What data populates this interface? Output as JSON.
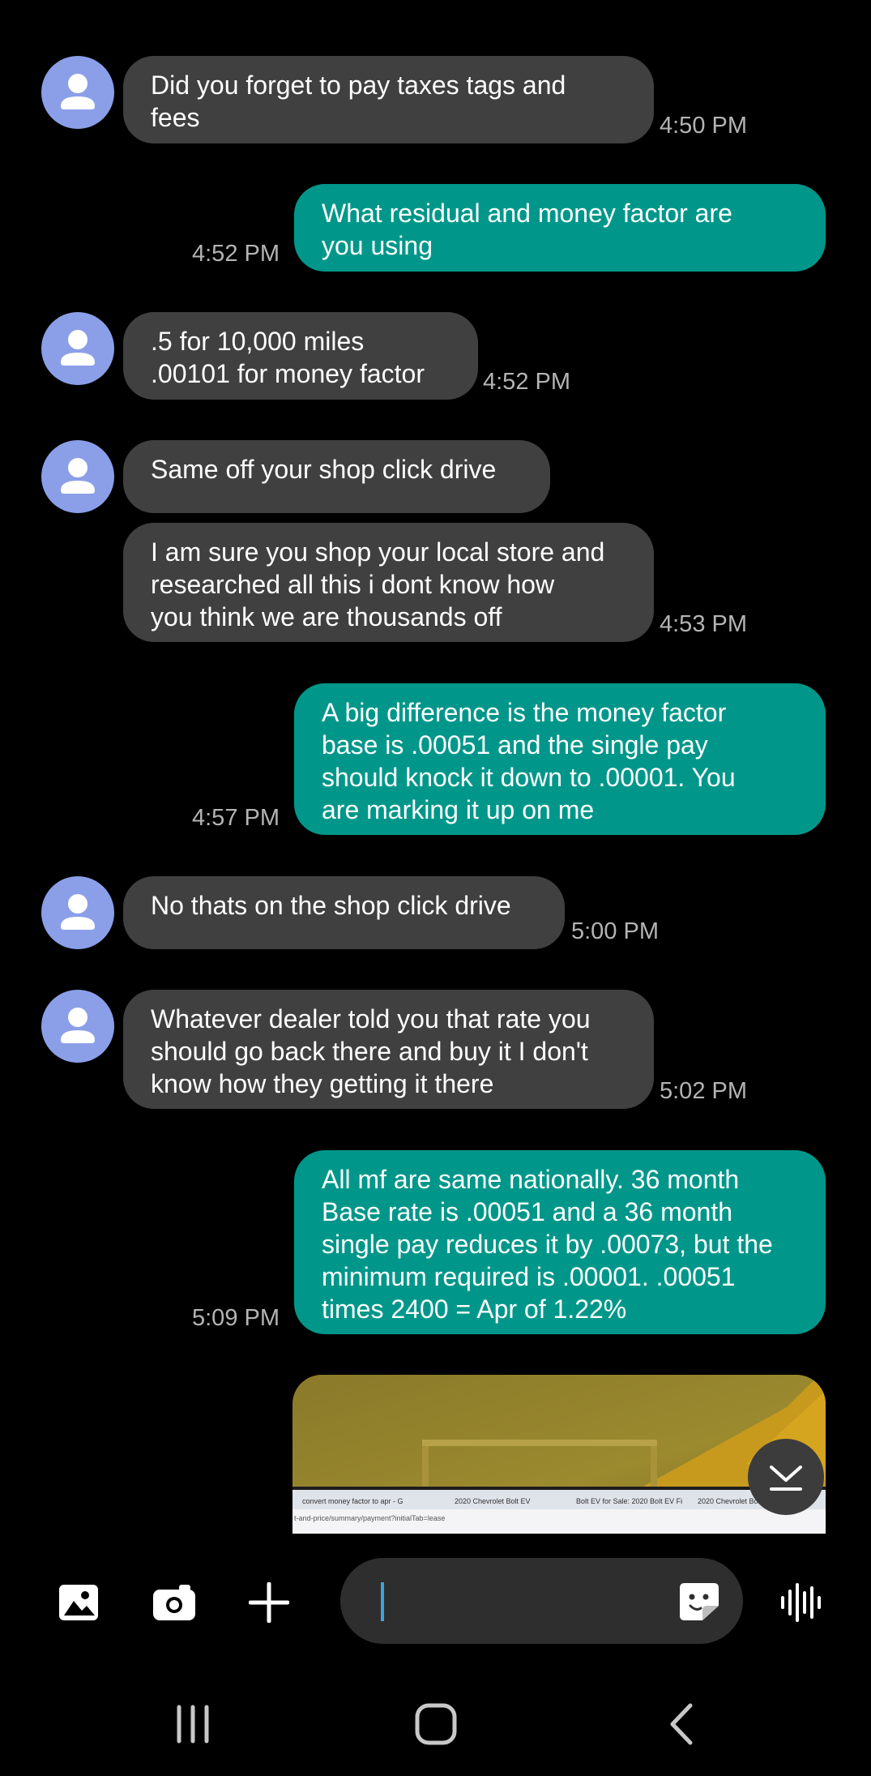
{
  "messages": [
    {
      "text": "Did you forget to pay taxes tags and\nfees",
      "time": "4:50 PM"
    },
    {
      "text": "What residual and money factor are\nyou using",
      "time": "4:52 PM"
    },
    {
      "text": ".5 for 10,000 miles\n.00101 for money factor",
      "time": "4:52 PM"
    },
    {
      "text": "Same off your shop click drive",
      "time": ""
    },
    {
      "text": "I am sure you shop your local store and\nresearched all this i dont know how\nyou think we are thousands off",
      "time": "4:53 PM"
    },
    {
      "text": "A big difference is the money factor\nbase is .00051 and the single pay\nshould knock it down to .00001. You\nare marking it up on me",
      "time": "4:57 PM"
    },
    {
      "text": "No thats on the shop click drive",
      "time": "5:00 PM"
    },
    {
      "text": "Whatever dealer told you that rate you\nshould go back there and buy it I don't\nknow how they getting it there",
      "time": "5:02 PM"
    },
    {
      "text": "All mf are same nationally. 36 month\nBase rate is .00051 and a 36 month\nsingle pay reduces it by .00073, but the\nminimum required is .00001.    .00051\ntimes 2400 = Apr of 1.22%",
      "time": "5:09 PM"
    }
  ],
  "image_preview": {
    "tabs": [
      "convert money factor to apr - G",
      "2020 Chevrolet Bolt EV",
      "Bolt EV for Sale: 2020 Bolt EV Fi",
      "2020 Chevrolet Bolt EV"
    ],
    "url": "t-and-price/summary/payment?initialTab=lease"
  },
  "composer": {
    "placeholder": ""
  },
  "colors": {
    "background": "#000000",
    "incoming_bubble": "#404040",
    "outgoing_bubble": "#00978a",
    "avatar": "#8b9fe8",
    "timestamp": "#b4b4b4",
    "input_pill": "#2e2e2e",
    "caret": "#3aa6dc"
  },
  "icons": {
    "toolbar": [
      "gallery-icon",
      "camera-icon",
      "plus-icon",
      "sticker-icon",
      "voice-icon"
    ],
    "nav": [
      "recents-icon",
      "home-icon",
      "back-icon"
    ],
    "scroll": "chevron-down-icon"
  }
}
